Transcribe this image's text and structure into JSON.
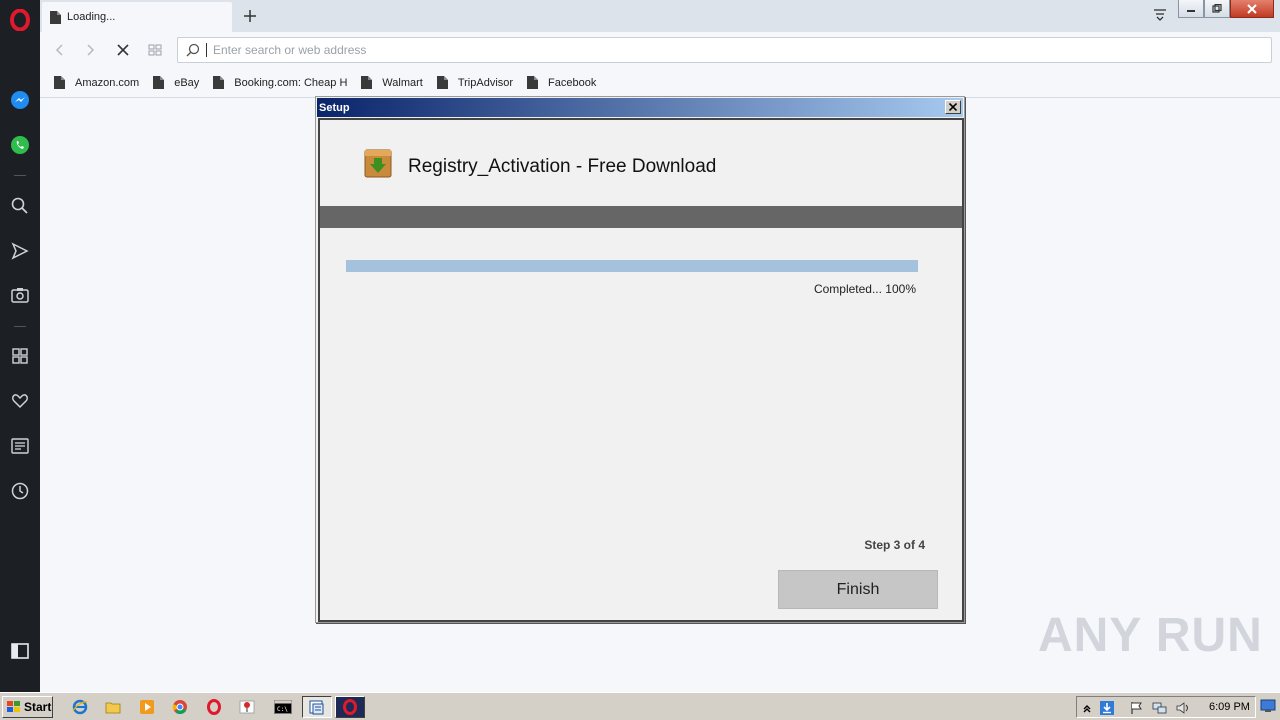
{
  "browser": {
    "tab": {
      "title": "Loading..."
    },
    "address_bar": {
      "placeholder": "Enter search or web address",
      "value": ""
    },
    "bookmarks": [
      {
        "label": "Amazon.com"
      },
      {
        "label": "eBay"
      },
      {
        "label": "Booking.com: Cheap Ho"
      },
      {
        "label": "Walmart"
      },
      {
        "label": "TripAdvisor"
      },
      {
        "label": "Facebook"
      }
    ]
  },
  "dialog": {
    "window_title": "Setup",
    "heading": "Registry_Activation - Free Download",
    "progress": {
      "percent": 100,
      "text": "Completed... 100%"
    },
    "step": "Step 3 of 4",
    "finish_label": "Finish"
  },
  "watermark": "ANY RUN",
  "taskbar": {
    "start_label": "Start",
    "clock": "6:09 PM"
  },
  "colors": {
    "sidebar": "#1c1f24",
    "opera_red": "#e0192c",
    "dialog_titlebar_start": "#0a246a",
    "progress_fill": "#a4c2db",
    "band": "#666666",
    "finish_button": "#c6c6c6"
  }
}
